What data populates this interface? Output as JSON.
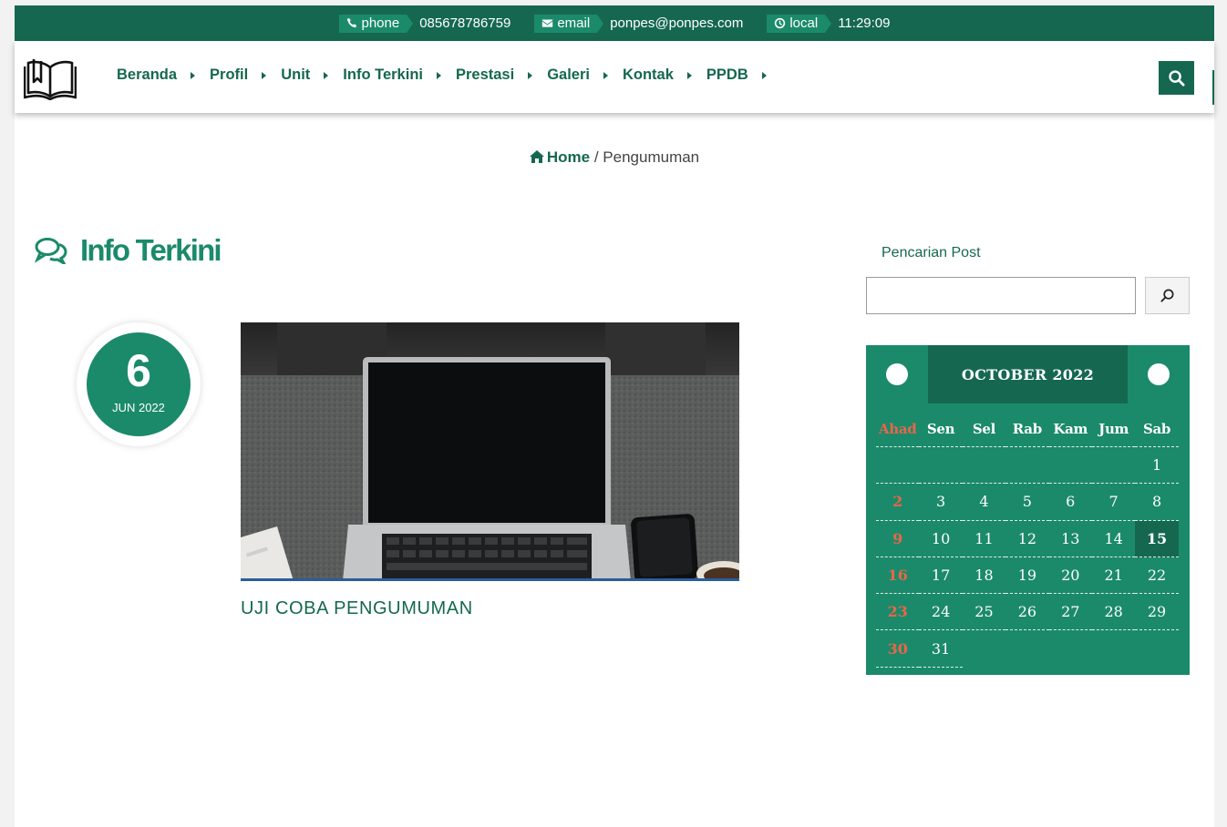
{
  "topbar": {
    "phone_label": "phone",
    "phone_value": "085678786759",
    "email_label": "email",
    "email_value": "ponpes@ponpes.com",
    "local_label": "local",
    "local_value": "11:29:09"
  },
  "nav": {
    "items": [
      {
        "label": "Beranda"
      },
      {
        "label": "Profil"
      },
      {
        "label": "Unit"
      },
      {
        "label": "Info Terkini"
      },
      {
        "label": "Prestasi"
      },
      {
        "label": "Galeri"
      },
      {
        "label": "Kontak"
      },
      {
        "label": "PPDB"
      }
    ]
  },
  "breadcrumb": {
    "home": "Home",
    "separator": "/",
    "current": "Pengumuman"
  },
  "section": {
    "title": "Info Terkini"
  },
  "post": {
    "day": "6",
    "month_year": "JUN 2022",
    "title": "UJI COBA PENGUMUMAN"
  },
  "sidebar": {
    "search_title": "Pencarian Post",
    "search_value": ""
  },
  "calendar": {
    "title": "OCTOBER 2022",
    "weekdays": [
      "Ahad",
      "Sen",
      "Sel",
      "Rab",
      "Kam",
      "Jum",
      "Sab"
    ],
    "weeks": [
      [
        "",
        "",
        "",
        "",
        "",
        "",
        "1"
      ],
      [
        "2",
        "3",
        "4",
        "5",
        "6",
        "7",
        "8"
      ],
      [
        "9",
        "10",
        "11",
        "12",
        "13",
        "14",
        "15"
      ],
      [
        "16",
        "17",
        "18",
        "19",
        "20",
        "21",
        "22"
      ],
      [
        "23",
        "24",
        "25",
        "26",
        "27",
        "28",
        "29"
      ],
      [
        "30",
        "31",
        "",
        "",
        "",
        "",
        ""
      ]
    ],
    "today": "15"
  },
  "colors": {
    "brand_dark": "#15684f",
    "brand": "#1b8a6a",
    "sunday": "#e8664a"
  }
}
